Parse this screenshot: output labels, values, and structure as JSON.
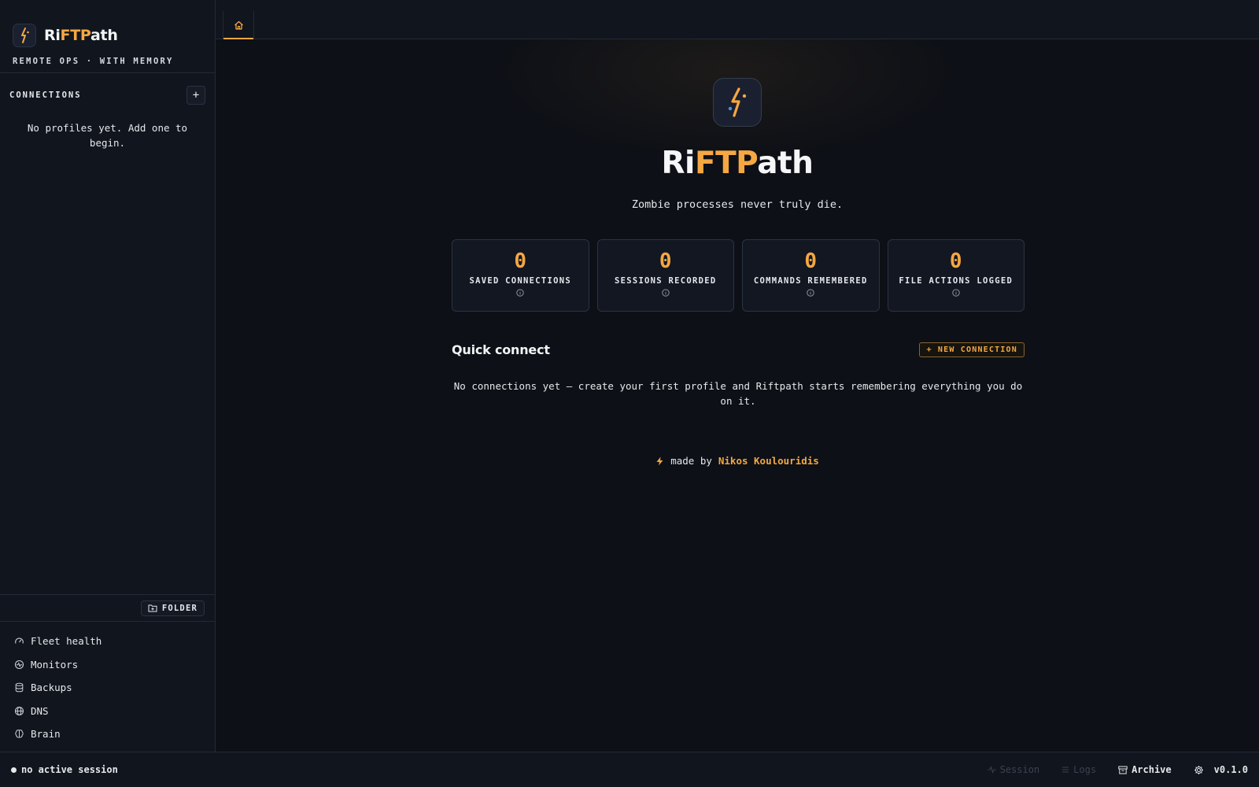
{
  "app": {
    "name_part1": "Ri",
    "name_accent": "FTP",
    "name_part2": "ath",
    "tagline": "REMOTE OPS · WITH MEMORY"
  },
  "sidebar": {
    "connections_title": "CONNECTIONS",
    "add_label": "+",
    "empty_text": "No profiles yet. Add one to begin.",
    "folder_label": "FOLDER",
    "nav": [
      {
        "label": "Fleet health",
        "icon": "gauge-icon"
      },
      {
        "label": "Monitors",
        "icon": "monitor-icon"
      },
      {
        "label": "Backups",
        "icon": "database-icon"
      },
      {
        "label": "DNS",
        "icon": "globe-icon"
      },
      {
        "label": "Brain",
        "icon": "brain-icon"
      }
    ]
  },
  "tabs": [
    {
      "name": "home",
      "icon": "home-icon",
      "active": true
    }
  ],
  "hero": {
    "title_part1": "Ri",
    "title_accent": "FTP",
    "title_part2": "ath",
    "subtitle": "Zombie processes never truly die."
  },
  "stats": [
    {
      "value": "0",
      "label": "SAVED CONNECTIONS"
    },
    {
      "value": "0",
      "label": "SESSIONS RECORDED"
    },
    {
      "value": "0",
      "label": "COMMANDS REMEMBERED"
    },
    {
      "value": "0",
      "label": "FILE ACTIONS LOGGED"
    }
  ],
  "quick_connect": {
    "title": "Quick connect",
    "new_button": "+ NEW CONNECTION",
    "empty_text": "No connections yet — create your first profile and Riftpath starts remembering everything you do on it."
  },
  "footer": {
    "made_by": "made by",
    "author": "Nikos Koulouridis"
  },
  "statusbar": {
    "session_status": "no active session",
    "session_label": "Session",
    "logs_label": "Logs",
    "archive_label": "Archive",
    "version": "v0.1.0"
  },
  "colors": {
    "accent": "#f5a742",
    "background": "#0d1016",
    "panel": "#11151d",
    "border": "#232a36"
  }
}
